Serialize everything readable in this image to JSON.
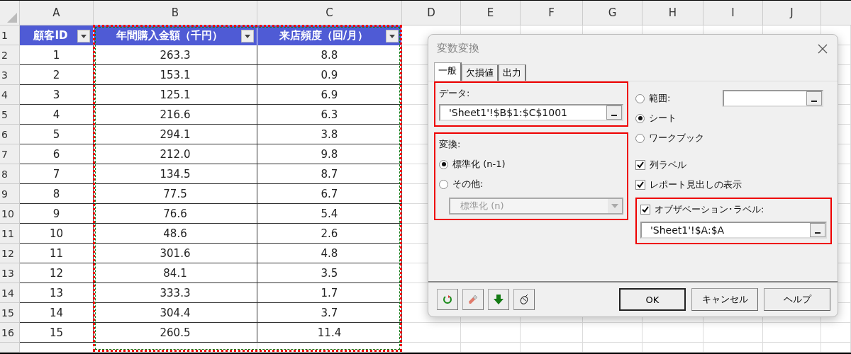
{
  "sheet": {
    "column_headers": [
      "A",
      "B",
      "C",
      "D",
      "E",
      "F",
      "G",
      "H",
      "I",
      "J"
    ],
    "row_headers": [
      "1",
      "2",
      "3",
      "4",
      "5",
      "6",
      "7",
      "8",
      "9",
      "10",
      "11",
      "12",
      "13",
      "14",
      "15",
      "16"
    ],
    "table": {
      "columns": [
        {
          "label": "顧客ID"
        },
        {
          "label": "年間購入金額（千円）"
        },
        {
          "label": "来店頻度（回/月）"
        }
      ],
      "rows": [
        [
          "1",
          "263.3",
          "8.8"
        ],
        [
          "2",
          "153.1",
          "0.9"
        ],
        [
          "3",
          "125.1",
          "6.9"
        ],
        [
          "4",
          "216.6",
          "6.3"
        ],
        [
          "5",
          "294.1",
          "3.8"
        ],
        [
          "6",
          "212.0",
          "9.8"
        ],
        [
          "7",
          "134.5",
          "8.7"
        ],
        [
          "8",
          "77.5",
          "6.7"
        ],
        [
          "9",
          "76.6",
          "5.4"
        ],
        [
          "10",
          "48.6",
          "2.6"
        ],
        [
          "11",
          "301.6",
          "4.8"
        ],
        [
          "12",
          "84.1",
          "3.5"
        ],
        [
          "13",
          "333.3",
          "1.7"
        ],
        [
          "14",
          "304.4",
          "3.7"
        ],
        [
          "15",
          "260.5",
          "11.4"
        ]
      ]
    }
  },
  "dialog": {
    "title": "変数変換",
    "tabs": [
      {
        "label": "一般",
        "selected": true
      },
      {
        "label": "欠損値",
        "selected": false
      },
      {
        "label": "出力",
        "selected": false
      }
    ],
    "data_group": {
      "label": "データ:",
      "value": "'Sheet1'!$B$1:$C$1001"
    },
    "transform_group": {
      "label": "変換:",
      "options": [
        {
          "label": "標準化 (n-1)",
          "selected": true
        },
        {
          "label": "その他:",
          "selected": false
        }
      ],
      "dropdown": {
        "value": "標準化 (n)",
        "disabled": true
      }
    },
    "output_options": [
      {
        "label": "範囲:",
        "selected": false
      },
      {
        "label": "シート",
        "selected": true
      },
      {
        "label": "ワークブック",
        "selected": false
      }
    ],
    "checkboxes": [
      {
        "label": "列ラベル",
        "checked": true
      },
      {
        "label": "レポート見出しの表示",
        "checked": true
      }
    ],
    "observation": {
      "label": "オブザベーション･ラベル:",
      "checked": true,
      "value": "'Sheet1'!$A:$A"
    },
    "buttons": [
      "OK",
      "キャンセル",
      "ヘルプ"
    ]
  }
}
